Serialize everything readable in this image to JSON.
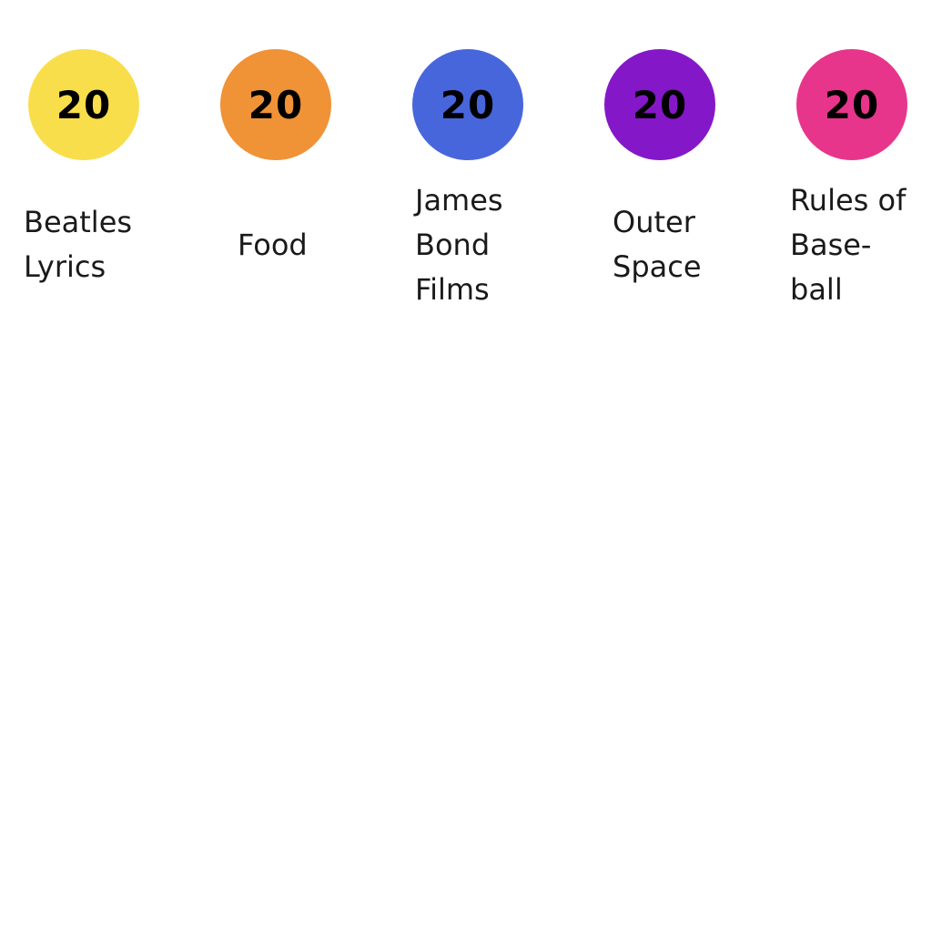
{
  "categories": [
    {
      "score": "20",
      "label": "Beatles\nLyrics",
      "color": "#F9DE4B"
    },
    {
      "score": "20",
      "label": "Food",
      "color": "#F09236"
    },
    {
      "score": "20",
      "label": "James\nBond\nFilms",
      "color": "#4866DC"
    },
    {
      "score": "20",
      "label": "Outer\nSpace",
      "color": "#8418C8"
    },
    {
      "score": "20",
      "label": "Rules of\nBase-\nball",
      "color": "#E8358C"
    }
  ]
}
